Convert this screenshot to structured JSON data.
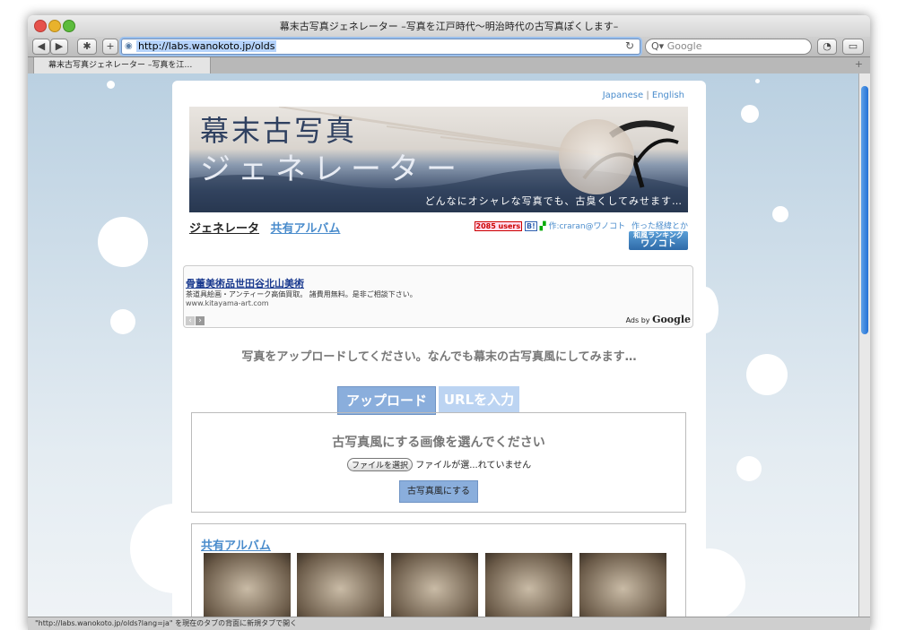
{
  "window": {
    "title": "幕末古写真ジェネレーター –写真を江戸時代〜明治時代の古写真ぽくします–"
  },
  "toolbar": {
    "url": "http://labs.wanokoto.jp/olds",
    "search_placeholder": "Google",
    "back_icon": "◀",
    "forward_icon": "▶",
    "gear_icon": "✱",
    "add_icon": "+",
    "reload_icon": "↻",
    "bookmark_icon": "▭",
    "history_icon": "◔",
    "search_icon": "Q▾"
  },
  "tab": {
    "label": "幕末古写真ジェネレーター –写真を江…",
    "plus": "+"
  },
  "page": {
    "lang_japanese": "Japanese",
    "lang_sep": "|",
    "lang_english": "English",
    "banner": {
      "title1": "幕末古写真",
      "title2": "ジェネレーター",
      "subtitle": "どんなにオシャレな写真でも、古臭くしてみせます…"
    },
    "nav": {
      "generator": "ジェネレータ",
      "album": "共有アルバム"
    },
    "meta": {
      "users": "2085 users",
      "hatena": "B!",
      "author": "作:craran@ワノコト",
      "story": "作った経緯とか",
      "rank_line1": "和風ランキング",
      "rank_line2": "ワノコト"
    },
    "ad": {
      "title": "骨董美術品世田谷北山美術",
      "desc": "茶道具絵画・アンティーク高価買取。 諸費用無料。是非ご相談下さい。",
      "url": "www.kitayama-art.com",
      "prev": "‹",
      "next": "›",
      "ads_by": "Ads by",
      "google": "Google"
    },
    "intro": "写真をアップロードしてください。なんでも幕末の古写真風にしてみます…",
    "tabs": {
      "upload": "アップロード",
      "url": "URLを入力"
    },
    "upload": {
      "heading": "古写真風にする画像を選んでください",
      "file_button": "ファイルを選択",
      "file_status": "ファイルが選...れていません",
      "submit": "古写真風にする"
    },
    "album": {
      "title": "共有アルバム"
    }
  },
  "status": {
    "text": "\"http://labs.wanokoto.jp/olds?lang=ja\" を現在のタブの背面に新規タブで開く"
  },
  "colors": {
    "accent": "#4a8ccc",
    "button": "#8aaedc",
    "users_red": "#cc0000"
  }
}
